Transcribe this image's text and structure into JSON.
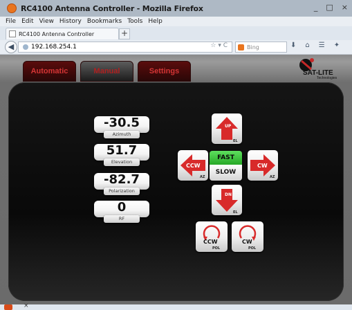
{
  "window": {
    "title": "RC4100 Antenna Controller - Mozilla Firefox",
    "min": "_",
    "max": "□",
    "close": "×"
  },
  "menu": [
    "File",
    "Edit",
    "View",
    "History",
    "Bookmarks",
    "Tools",
    "Help"
  ],
  "browser_tab": {
    "label": "RC4100 Antenna Controller",
    "new_tab": "+"
  },
  "nav": {
    "url": "192.168.254.1",
    "url_extra": "☆ ▾ C",
    "search_placeholder": "Bing"
  },
  "app": {
    "tabs": [
      "Automatic",
      "Manual",
      "Settings"
    ],
    "active_tab": "Manual",
    "logo_text": "SAT-LITE",
    "logo_sub": "Technologies",
    "readouts": [
      {
        "value": "-30.5",
        "label": "Azimuth"
      },
      {
        "value": "51.7",
        "label": "Elevation"
      },
      {
        "value": "-82.7",
        "label": "Polarization"
      },
      {
        "value": "0",
        "label": "RF"
      }
    ],
    "buttons": {
      "up": {
        "main": "UP",
        "sub": "EL"
      },
      "down": {
        "main": "DN",
        "sub": "EL"
      },
      "ccw_az": {
        "main": "CCW",
        "sub": "AZ"
      },
      "cw_az": {
        "main": "CW",
        "sub": "AZ"
      },
      "fast": "FAST",
      "slow": "SLOW",
      "ccw_pol": {
        "main": "CCW",
        "sub": "POL"
      },
      "cw_pol": {
        "main": "CW",
        "sub": "POL"
      }
    }
  },
  "status": {
    "close": "×"
  },
  "colors": {
    "accent_red": "#d82a2a",
    "fast_green": "#2fbf2f",
    "panel": "#0f0f0f"
  }
}
